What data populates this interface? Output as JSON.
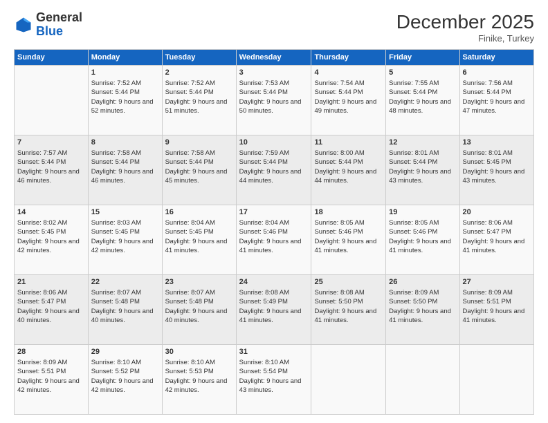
{
  "header": {
    "logo_general": "General",
    "logo_blue": "Blue",
    "month_year": "December 2025",
    "location": "Finike, Turkey"
  },
  "days_of_week": [
    "Sunday",
    "Monday",
    "Tuesday",
    "Wednesday",
    "Thursday",
    "Friday",
    "Saturday"
  ],
  "weeks": [
    [
      {
        "day": "",
        "sunrise": "",
        "sunset": "",
        "daylight": ""
      },
      {
        "day": "1",
        "sunrise": "Sunrise: 7:52 AM",
        "sunset": "Sunset: 5:44 PM",
        "daylight": "Daylight: 9 hours and 52 minutes."
      },
      {
        "day": "2",
        "sunrise": "Sunrise: 7:52 AM",
        "sunset": "Sunset: 5:44 PM",
        "daylight": "Daylight: 9 hours and 51 minutes."
      },
      {
        "day": "3",
        "sunrise": "Sunrise: 7:53 AM",
        "sunset": "Sunset: 5:44 PM",
        "daylight": "Daylight: 9 hours and 50 minutes."
      },
      {
        "day": "4",
        "sunrise": "Sunrise: 7:54 AM",
        "sunset": "Sunset: 5:44 PM",
        "daylight": "Daylight: 9 hours and 49 minutes."
      },
      {
        "day": "5",
        "sunrise": "Sunrise: 7:55 AM",
        "sunset": "Sunset: 5:44 PM",
        "daylight": "Daylight: 9 hours and 48 minutes."
      },
      {
        "day": "6",
        "sunrise": "Sunrise: 7:56 AM",
        "sunset": "Sunset: 5:44 PM",
        "daylight": "Daylight: 9 hours and 47 minutes."
      }
    ],
    [
      {
        "day": "7",
        "sunrise": "Sunrise: 7:57 AM",
        "sunset": "Sunset: 5:44 PM",
        "daylight": "Daylight: 9 hours and 46 minutes."
      },
      {
        "day": "8",
        "sunrise": "Sunrise: 7:58 AM",
        "sunset": "Sunset: 5:44 PM",
        "daylight": "Daylight: 9 hours and 46 minutes."
      },
      {
        "day": "9",
        "sunrise": "Sunrise: 7:58 AM",
        "sunset": "Sunset: 5:44 PM",
        "daylight": "Daylight: 9 hours and 45 minutes."
      },
      {
        "day": "10",
        "sunrise": "Sunrise: 7:59 AM",
        "sunset": "Sunset: 5:44 PM",
        "daylight": "Daylight: 9 hours and 44 minutes."
      },
      {
        "day": "11",
        "sunrise": "Sunrise: 8:00 AM",
        "sunset": "Sunset: 5:44 PM",
        "daylight": "Daylight: 9 hours and 44 minutes."
      },
      {
        "day": "12",
        "sunrise": "Sunrise: 8:01 AM",
        "sunset": "Sunset: 5:44 PM",
        "daylight": "Daylight: 9 hours and 43 minutes."
      },
      {
        "day": "13",
        "sunrise": "Sunrise: 8:01 AM",
        "sunset": "Sunset: 5:45 PM",
        "daylight": "Daylight: 9 hours and 43 minutes."
      }
    ],
    [
      {
        "day": "14",
        "sunrise": "Sunrise: 8:02 AM",
        "sunset": "Sunset: 5:45 PM",
        "daylight": "Daylight: 9 hours and 42 minutes."
      },
      {
        "day": "15",
        "sunrise": "Sunrise: 8:03 AM",
        "sunset": "Sunset: 5:45 PM",
        "daylight": "Daylight: 9 hours and 42 minutes."
      },
      {
        "day": "16",
        "sunrise": "Sunrise: 8:04 AM",
        "sunset": "Sunset: 5:45 PM",
        "daylight": "Daylight: 9 hours and 41 minutes."
      },
      {
        "day": "17",
        "sunrise": "Sunrise: 8:04 AM",
        "sunset": "Sunset: 5:46 PM",
        "daylight": "Daylight: 9 hours and 41 minutes."
      },
      {
        "day": "18",
        "sunrise": "Sunrise: 8:05 AM",
        "sunset": "Sunset: 5:46 PM",
        "daylight": "Daylight: 9 hours and 41 minutes."
      },
      {
        "day": "19",
        "sunrise": "Sunrise: 8:05 AM",
        "sunset": "Sunset: 5:46 PM",
        "daylight": "Daylight: 9 hours and 41 minutes."
      },
      {
        "day": "20",
        "sunrise": "Sunrise: 8:06 AM",
        "sunset": "Sunset: 5:47 PM",
        "daylight": "Daylight: 9 hours and 41 minutes."
      }
    ],
    [
      {
        "day": "21",
        "sunrise": "Sunrise: 8:06 AM",
        "sunset": "Sunset: 5:47 PM",
        "daylight": "Daylight: 9 hours and 40 minutes."
      },
      {
        "day": "22",
        "sunrise": "Sunrise: 8:07 AM",
        "sunset": "Sunset: 5:48 PM",
        "daylight": "Daylight: 9 hours and 40 minutes."
      },
      {
        "day": "23",
        "sunrise": "Sunrise: 8:07 AM",
        "sunset": "Sunset: 5:48 PM",
        "daylight": "Daylight: 9 hours and 40 minutes."
      },
      {
        "day": "24",
        "sunrise": "Sunrise: 8:08 AM",
        "sunset": "Sunset: 5:49 PM",
        "daylight": "Daylight: 9 hours and 41 minutes."
      },
      {
        "day": "25",
        "sunrise": "Sunrise: 8:08 AM",
        "sunset": "Sunset: 5:50 PM",
        "daylight": "Daylight: 9 hours and 41 minutes."
      },
      {
        "day": "26",
        "sunrise": "Sunrise: 8:09 AM",
        "sunset": "Sunset: 5:50 PM",
        "daylight": "Daylight: 9 hours and 41 minutes."
      },
      {
        "day": "27",
        "sunrise": "Sunrise: 8:09 AM",
        "sunset": "Sunset: 5:51 PM",
        "daylight": "Daylight: 9 hours and 41 minutes."
      }
    ],
    [
      {
        "day": "28",
        "sunrise": "Sunrise: 8:09 AM",
        "sunset": "Sunset: 5:51 PM",
        "daylight": "Daylight: 9 hours and 42 minutes."
      },
      {
        "day": "29",
        "sunrise": "Sunrise: 8:10 AM",
        "sunset": "Sunset: 5:52 PM",
        "daylight": "Daylight: 9 hours and 42 minutes."
      },
      {
        "day": "30",
        "sunrise": "Sunrise: 8:10 AM",
        "sunset": "Sunset: 5:53 PM",
        "daylight": "Daylight: 9 hours and 42 minutes."
      },
      {
        "day": "31",
        "sunrise": "Sunrise: 8:10 AM",
        "sunset": "Sunset: 5:54 PM",
        "daylight": "Daylight: 9 hours and 43 minutes."
      },
      {
        "day": "",
        "sunrise": "",
        "sunset": "",
        "daylight": ""
      },
      {
        "day": "",
        "sunrise": "",
        "sunset": "",
        "daylight": ""
      },
      {
        "day": "",
        "sunrise": "",
        "sunset": "",
        "daylight": ""
      }
    ]
  ]
}
